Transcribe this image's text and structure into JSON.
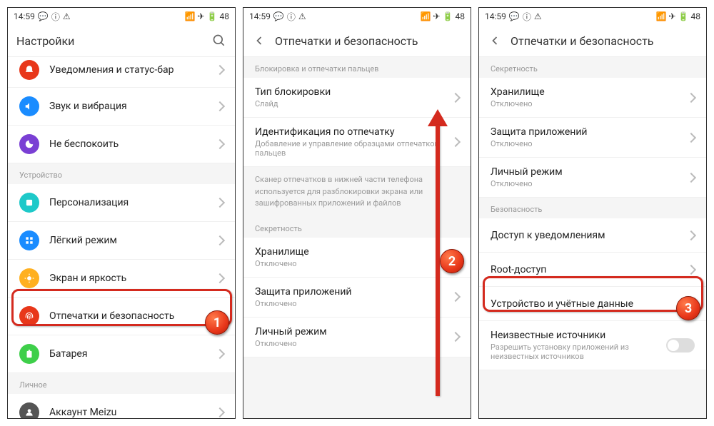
{
  "statusbar": {
    "time": "14:59",
    "battery": "48"
  },
  "p1": {
    "header": "Настройки",
    "partial_top": "Уведомления и статус-бар",
    "items": [
      {
        "label": "Звук и вибрация",
        "color": "#1a8cff"
      },
      {
        "label": "Не беспокоить",
        "color": "#7a3fd4"
      }
    ],
    "sec2": "Устройство",
    "items2": [
      {
        "label": "Персонализация",
        "color": "#1ec9c9"
      },
      {
        "label": "Лёгкий режим",
        "color": "#1a8cff"
      },
      {
        "label": "Экран и яркость",
        "color": "#ffb020"
      },
      {
        "label": "Отпечатки и безопасность",
        "color": "#e8371a"
      },
      {
        "label": "Батарея",
        "color": "#3ecf4a"
      }
    ],
    "sec3": "Личное",
    "items3": [
      {
        "label": "Аккаунт Meizu",
        "color": "#555"
      }
    ]
  },
  "p2": {
    "header": "Отпечатки и безопасность",
    "sec1": "Блокировка и отпечатки пальцев",
    "items1": [
      {
        "title": "Тип блокировки",
        "sub": "Слайд"
      },
      {
        "title": "Идентификация по отпечатку",
        "sub": "Добавление и управление образцами отпечатков пальцев"
      }
    ],
    "info": "Сканер отпечатков в нижней части телефона используется для разблокировки экрана или зашифрованных приложений и файлов",
    "sec2": "Секретность",
    "items2": [
      {
        "title": "Хранилище",
        "sub": "Отключено"
      },
      {
        "title": "Защита приложений",
        "sub": "Отключено"
      },
      {
        "title": "Личный режим",
        "sub": "Отключено"
      }
    ]
  },
  "p3": {
    "header": "Отпечатки и безопасность",
    "sec1": "Секретность",
    "items1": [
      {
        "title": "Хранилище",
        "sub": "Отключено"
      },
      {
        "title": "Защита приложений",
        "sub": "Отключено"
      },
      {
        "title": "Личный режим",
        "sub": "Отключено"
      }
    ],
    "sec2": "Безопасность",
    "items2": [
      {
        "title": "Доступ к уведомлениям"
      },
      {
        "title": "Root-доступ"
      },
      {
        "title": "Устройство и учётные данные"
      },
      {
        "title": "Неизвестные источники",
        "sub": "Разрешить установку приложений из неизвестных источников",
        "toggle": true
      }
    ]
  }
}
